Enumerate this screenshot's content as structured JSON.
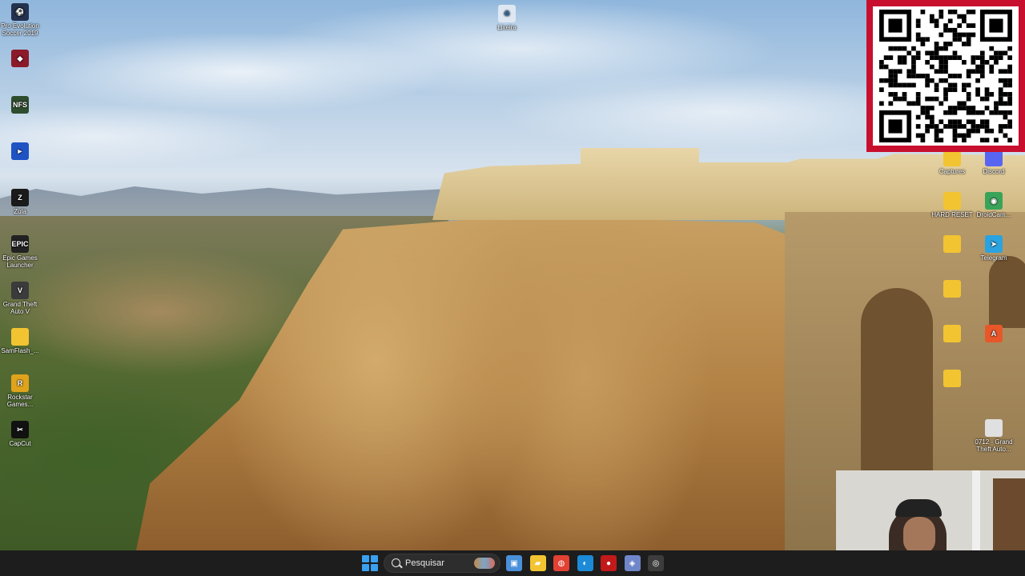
{
  "desktop": {
    "icons_left": [
      {
        "label": "Pro Evolution Soccer 2019",
        "glyph": "⚽",
        "color": "#24324f"
      },
      {
        "label": "",
        "glyph": "◆",
        "color": "#8b1a2a"
      },
      {
        "label": "",
        "glyph": "NFS",
        "color": "#2e4d2e"
      },
      {
        "label": "",
        "glyph": "►",
        "color": "#1f53c4"
      },
      {
        "label": "Zula",
        "glyph": "Z",
        "color": "#1b1b1b"
      },
      {
        "label": "Epic Games Launcher",
        "glyph": "EPIC",
        "color": "#222222"
      },
      {
        "label": "Grand Theft Auto V",
        "glyph": "V",
        "color": "#3b3b3b"
      },
      {
        "label": "SamFlash_...",
        "glyph": "",
        "color": "#f2c431"
      },
      {
        "label": "Rockstar Games...",
        "glyph": "R",
        "color": "#e0a31c"
      },
      {
        "label": "CapCut",
        "glyph": "✂",
        "color": "#111111"
      }
    ],
    "icon_top": {
      "label": "Lixeira",
      "glyph": "♲",
      "color": "#dfe8f2"
    },
    "icons_right": [
      {
        "label": "Captures",
        "glyph": "",
        "color": "#f2c431"
      },
      {
        "label": "Discord",
        "glyph": "",
        "color": "#5865f2"
      },
      {
        "label": "HARD RESET",
        "glyph": "",
        "color": "#f2c431"
      },
      {
        "label": "DroidCam...",
        "glyph": "◉",
        "color": "#3aa35a"
      },
      {
        "label": "Telegram",
        "glyph": "➤",
        "color": "#2aa3e0"
      },
      {
        "label": "",
        "glyph": "",
        "color": "#f2c431"
      },
      {
        "label": "",
        "glyph": "",
        "color": "#f2c431"
      },
      {
        "label": "",
        "glyph": "",
        "color": "#f2c431"
      },
      {
        "label": "",
        "glyph": "A",
        "color": "#e8572a"
      },
      {
        "label": "",
        "glyph": "",
        "color": "#f2c431"
      },
      {
        "label": "0712 - Grand Theft Auto...",
        "glyph": "",
        "color": "#e0e0e0"
      }
    ]
  },
  "taskbar": {
    "search_placeholder": "Pesquisar",
    "apps": [
      {
        "name": "task-view",
        "glyph": "▣",
        "color": "#4a90d9"
      },
      {
        "name": "file-explorer",
        "glyph": "▰",
        "color": "#f2c431"
      },
      {
        "name": "chrome",
        "glyph": "◍",
        "color": "#e34133"
      },
      {
        "name": "edge",
        "glyph": "◐",
        "color": "#1c8ad6"
      },
      {
        "name": "record",
        "glyph": "●",
        "color": "#c21a1a"
      },
      {
        "name": "settings-app",
        "glyph": "◈",
        "color": "#6f86c9"
      },
      {
        "name": "obs",
        "glyph": "◎",
        "color": "#3c3c3c"
      }
    ]
  }
}
